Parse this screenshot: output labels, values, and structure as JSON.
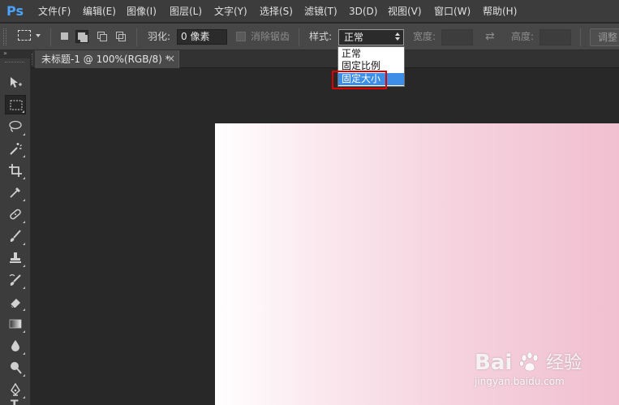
{
  "app": {
    "logo": "Ps"
  },
  "menu": {
    "items": [
      "文件(F)",
      "编辑(E)",
      "图像(I)",
      "图层(L)",
      "文字(Y)",
      "选择(S)",
      "滤镜(T)",
      "3D(D)",
      "视图(V)",
      "窗口(W)",
      "帮助(H)"
    ]
  },
  "options": {
    "feather_label": "羽化:",
    "feather_value": "0 像素",
    "antialias_label": "消除锯齿",
    "style_label": "样式:",
    "style_value": "正常",
    "width_label": "宽度:",
    "height_label": "高度:",
    "adjust_label": "调整"
  },
  "style_dropdown": {
    "options": [
      "正常",
      "固定比例",
      "固定大小"
    ],
    "highlighted": "固定大小",
    "highlight_color": "#3d8ee6",
    "annotation_color": "#e00000"
  },
  "document": {
    "tab_title": "未标题-1 @ 100%(RGB/8) *",
    "close_glyph": "×"
  },
  "toolbox": {
    "collapse_glyph": "»",
    "tools": [
      "move-tool",
      "rectangular-marquee-tool",
      "lasso-tool",
      "magic-wand-tool",
      "crop-tool",
      "eyedropper-tool",
      "spot-healing-brush-tool",
      "brush-tool",
      "clone-stamp-tool",
      "history-brush-tool",
      "eraser-tool",
      "gradient-tool",
      "blur-tool",
      "dodge-tool",
      "pen-tool",
      "type-tool"
    ],
    "type_glyph": "T"
  },
  "canvas": {
    "gradient_start": "#ffffff",
    "gradient_end": "#f1bfd0"
  },
  "watermark": {
    "brand": "Bai",
    "brand_suffix": "经验",
    "url": "jingyan.baidu.com"
  }
}
